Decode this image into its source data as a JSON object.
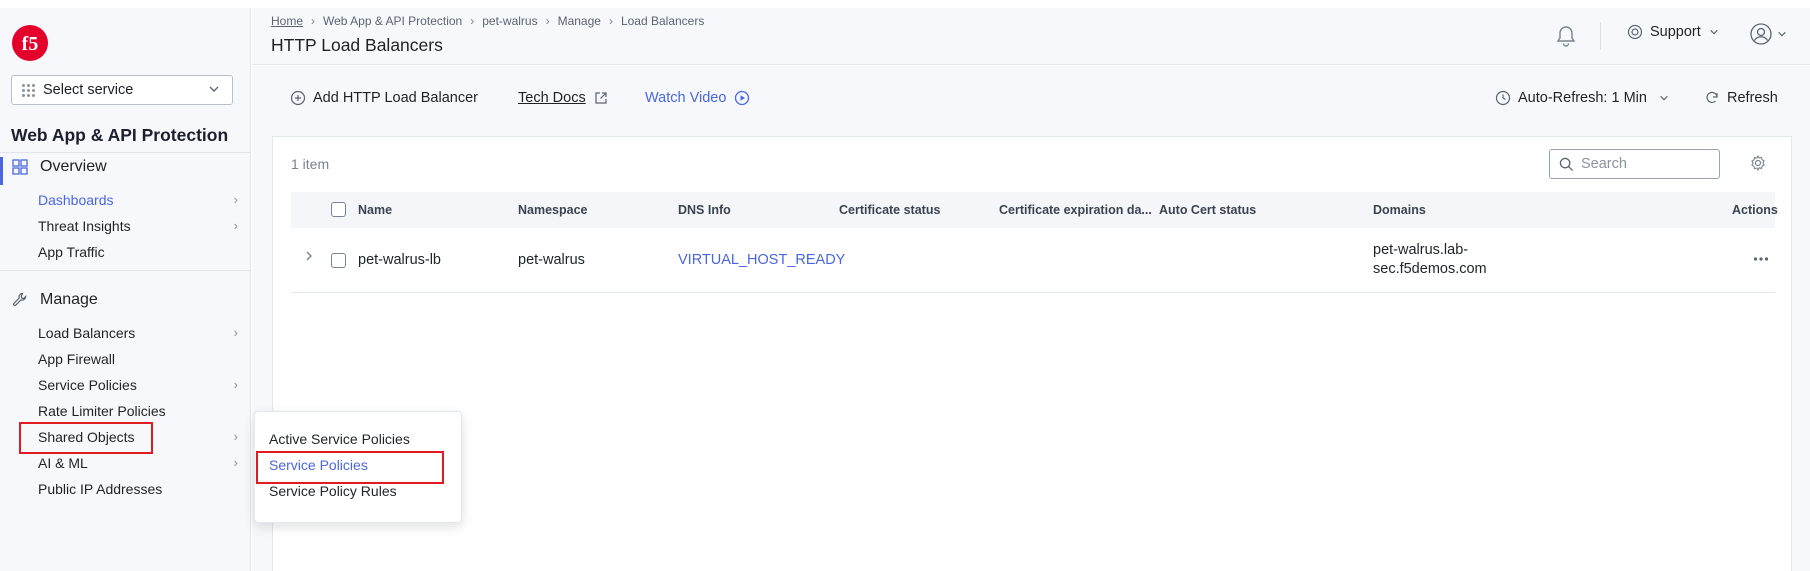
{
  "brand": {
    "logo_text": "f5",
    "logo_color": "#e4002b"
  },
  "service_selector": {
    "label": "Select service"
  },
  "sidebar": {
    "service_title": "Web App & API Protection",
    "overview": {
      "label": "Overview",
      "items": [
        {
          "label": "Dashboards",
          "has_submenu": true,
          "active": true
        },
        {
          "label": "Threat Insights",
          "has_submenu": true
        },
        {
          "label": "App Traffic",
          "has_submenu": false
        }
      ]
    },
    "manage": {
      "label": "Manage",
      "items": [
        {
          "label": "Load Balancers",
          "has_submenu": true
        },
        {
          "label": "App Firewall",
          "has_submenu": false
        },
        {
          "label": "Service Policies",
          "has_submenu": true,
          "highlighted": true
        },
        {
          "label": "Rate Limiter Policies",
          "has_submenu": false
        },
        {
          "label": "Shared Objects",
          "has_submenu": true
        },
        {
          "label": "AI & ML",
          "has_submenu": true
        },
        {
          "label": "Public IP Addresses",
          "has_submenu": false
        }
      ]
    }
  },
  "header": {
    "breadcrumb": [
      "Home",
      "Web App & API Protection",
      "pet-walrus",
      "Manage",
      "Load Balancers"
    ],
    "title": "HTTP Load Balancers",
    "support_label": "Support"
  },
  "toolbar": {
    "add_label": "Add HTTP Load Balancer",
    "tech_docs_label": "Tech Docs",
    "watch_video_label": "Watch Video",
    "auto_refresh_label": "Auto-Refresh: 1 Min",
    "refresh_label": "Refresh"
  },
  "table": {
    "item_count": "1 item",
    "search_placeholder": "Search",
    "columns": [
      "Name",
      "Namespace",
      "DNS Info",
      "Certificate status",
      "Certificate expiration da...",
      "Auto Cert status",
      "Domains",
      "Actions"
    ],
    "rows": [
      {
        "name": "pet-walrus-lb",
        "namespace": "pet-walrus",
        "dns_info": "VIRTUAL_HOST_READY",
        "certificate_status": "",
        "certificate_expiration": "",
        "auto_cert_status": "",
        "domains_line1": "pet-walrus.lab-",
        "domains_line2": "sec.f5demos.com"
      }
    ]
  },
  "flyout_menu": {
    "items": [
      {
        "label": "Active Service Policies"
      },
      {
        "label": "Service Policies",
        "selected": true
      },
      {
        "label": "Service Policy Rules"
      }
    ]
  },
  "colors": {
    "accent": "#4a66e0",
    "highlight": "#e01b22",
    "sidebar_bg": "#f6f8fb"
  }
}
